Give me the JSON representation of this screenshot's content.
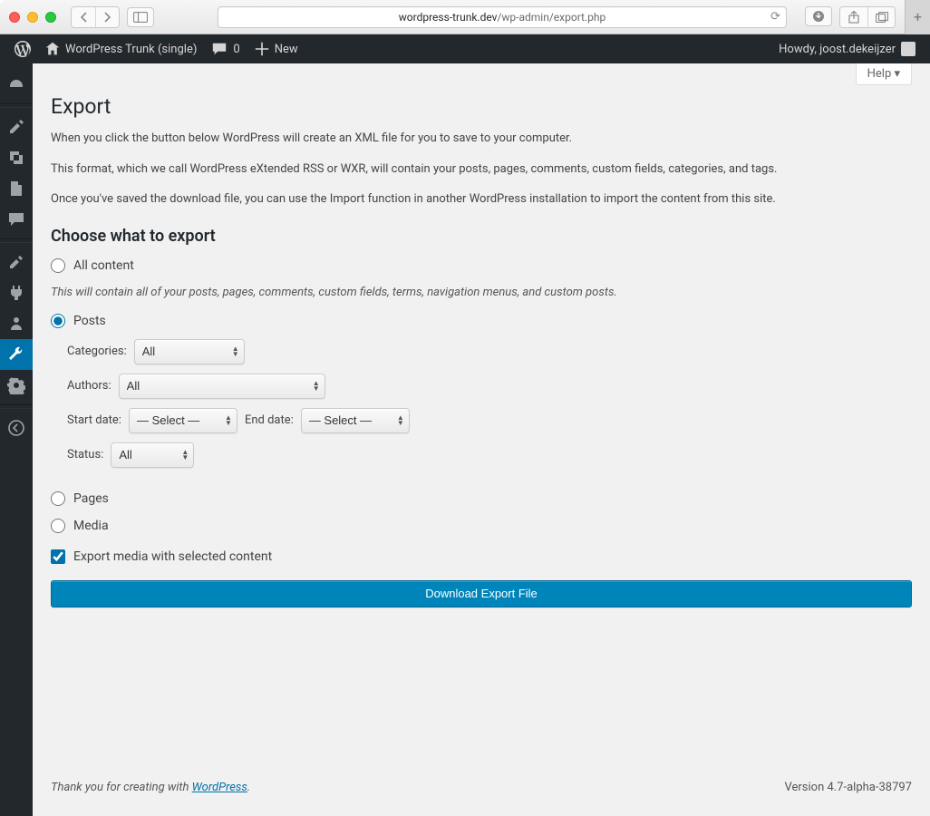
{
  "browser": {
    "url_host": "wordpress-trunk.dev",
    "url_path": "/wp-admin/export.php"
  },
  "adminbar": {
    "site_title": "WordPress Trunk (single)",
    "comment_count": "0",
    "new_label": "New",
    "howdy": "Howdy, joost.dekeijzer"
  },
  "screen": {
    "help_label": "Help ▾"
  },
  "page": {
    "title": "Export",
    "p1": "When you click the button below WordPress will create an XML file for you to save to your computer.",
    "p2": "This format, which we call WordPress eXtended RSS or WXR, will contain your posts, pages, comments, custom fields, categories, and tags.",
    "p3": "Once you've saved the download file, you can use the Import function in another WordPress installation to import the content from this site.",
    "choose_heading": "Choose what to export",
    "all_content_label": "All content",
    "all_content_desc": "This will contain all of your posts, pages, comments, custom fields, terms, navigation menus, and custom posts.",
    "posts_label": "Posts",
    "pages_label": "Pages",
    "media_label": "Media",
    "export_media_checkbox": "Export media with selected content",
    "filters": {
      "categories_label": "Categories:",
      "categories_value": "All",
      "authors_label": "Authors:",
      "authors_value": "All",
      "start_date_label": "Start date:",
      "start_date_value": "— Select —",
      "end_date_label": "End date:",
      "end_date_value": "— Select —",
      "status_label": "Status:",
      "status_value": "All"
    },
    "submit_label": "Download Export File"
  },
  "footer": {
    "thanks_prefix": "Thank you for creating with ",
    "thanks_link": "WordPress",
    "thanks_suffix": ".",
    "version": "Version 4.7-alpha-38797"
  }
}
